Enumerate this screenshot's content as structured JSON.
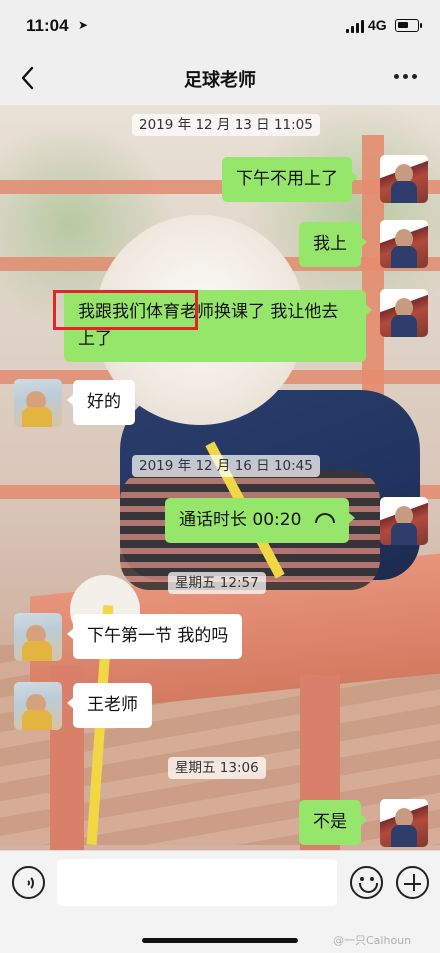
{
  "status_bar": {
    "time": "11:04",
    "network": "4G"
  },
  "nav": {
    "title": "足球老师"
  },
  "messages": {
    "ts1": "2019 年 12 月 13 日 11:05",
    "m1": "下午不用上了",
    "m2": "我上",
    "m3": "我跟我们体育老师换课了 我让他去上了",
    "m4": "好的",
    "ts2": "2019 年 12 月 16 日 10:45",
    "m5": "通话时长 00:20",
    "ts3": "星期五 12:57",
    "m6": "下午第一节 我的吗",
    "m7": "王老师",
    "ts4": "星期五 13:06",
    "m8": "不是"
  },
  "input": {
    "placeholder": ""
  },
  "icons": {
    "back": "back-arrow-icon",
    "more": "more-dots-icon",
    "location": "location-arrow-icon",
    "voice": "voice-icon",
    "emoji": "emoji-icon",
    "plus": "plus-icon",
    "call": "call-icon"
  },
  "colors": {
    "my_bubble": "#95e66b",
    "their_bubble": "#ffffff",
    "highlight": "#e2252b"
  },
  "watermark": "@一只Calhoun"
}
